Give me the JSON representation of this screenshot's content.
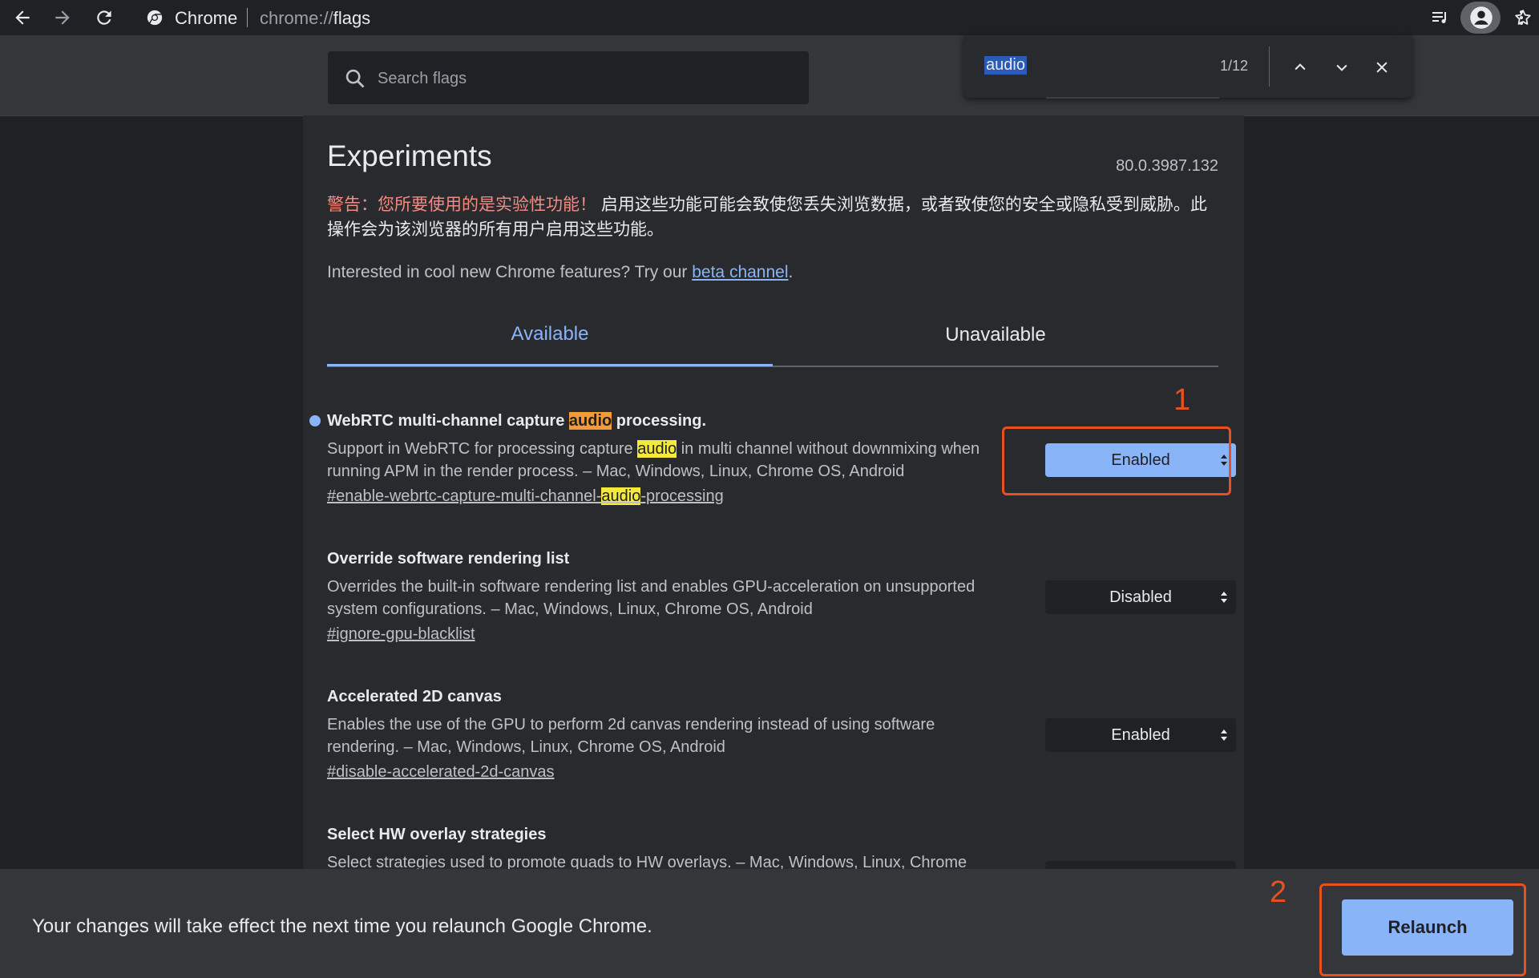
{
  "browser": {
    "chrome_label": "Chrome",
    "url_prefix": "chrome://",
    "url_path": "flags"
  },
  "search": {
    "placeholder": "Search flags"
  },
  "findbar": {
    "query": "audio",
    "count": "1/12"
  },
  "page": {
    "title": "Experiments",
    "version": "80.0.3987.132",
    "warning_red": "警告：您所要使用的是实验性功能！",
    "warning_rest": "启用这些功能可能会致使您丢失浏览数据，或者致使您的安全或隐私受到威胁。此操作会为该浏览器的所有用户启用这些功能。",
    "interested_text": "Interested in cool new Chrome features? Try our ",
    "beta_link": "beta channel",
    "interested_end": "."
  },
  "tabs": {
    "available": "Available",
    "unavailable": "Unavailable"
  },
  "flags": [
    {
      "title_pre": "WebRTC multi-channel capture ",
      "title_hl": "audio",
      "title_post": " processing.",
      "desc_pre": "Support in WebRTC for processing capture ",
      "desc_hl": "audio",
      "desc_post": " in multi channel without downmixing when running APM in the render process. – Mac, Windows, Linux, Chrome OS, Android",
      "link_pre": "#enable-webrtc-capture-multi-channel-",
      "link_hl": "audio",
      "link_post": "-processing",
      "value": "Enabled"
    },
    {
      "title": "Override software rendering list",
      "desc": "Overrides the built-in software rendering list and enables GPU-acceleration on unsupported system configurations. – Mac, Windows, Linux, Chrome OS, Android",
      "link": "#ignore-gpu-blacklist",
      "value": "Disabled"
    },
    {
      "title": "Accelerated 2D canvas",
      "desc": "Enables the use of the GPU to perform 2d canvas rendering instead of using software rendering. – Mac, Windows, Linux, Chrome OS, Android",
      "link": "#disable-accelerated-2d-canvas",
      "value": "Enabled"
    },
    {
      "title": "Select HW overlay strategies",
      "desc": "Select strategies used to promote quads to HW overlays. – Mac, Windows, Linux, Chrome"
    }
  ],
  "annotations": {
    "marker1": "1",
    "marker2": "2"
  },
  "bottom": {
    "message": "Your changes will take effect the next time you relaunch Google Chrome.",
    "relaunch_label": "Relaunch"
  },
  "colors": {
    "accent": "#8ab4f8",
    "annotation": "#e8501f",
    "highlight": "#f5e93b",
    "current_highlight": "#f29b38"
  }
}
